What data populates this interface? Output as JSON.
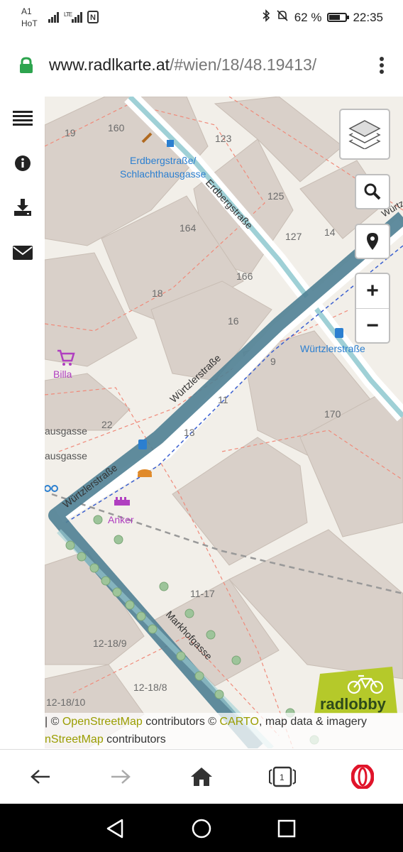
{
  "status": {
    "carrier_line1": "A1",
    "carrier_line2": "HoT",
    "network": "LTE",
    "battery": "62 %",
    "battery_level": 0.62,
    "time": "22:35"
  },
  "browser": {
    "url_host": "www.radlkarte.at",
    "url_path": "/#wien/18/48.19413/",
    "menu_icon": "kebab-menu-icon"
  },
  "sidebar": {
    "items": [
      {
        "icon": "menu-list-icon"
      },
      {
        "icon": "info-icon"
      },
      {
        "icon": "download-icon"
      },
      {
        "icon": "mail-icon"
      }
    ]
  },
  "map": {
    "controls": {
      "layers_icon": "layers-icon",
      "search_icon": "search-icon",
      "locate_icon": "location-pin-icon",
      "zoom_in": "+",
      "zoom_out": "−"
    },
    "labels": {
      "stop_1": "Erdbergstraße/",
      "stop_2": "Schlachthausgasse",
      "street_erdberg": "Erdbergstraße",
      "street_wuertzler": "Würtzlerstraße",
      "street_wuertzler_stop": "Würtzlerstraße",
      "street_wuertzler_2": "Würtzlerstraße",
      "street_markhof": "Markhofgasse",
      "street_wuertz_edge": "Würtz",
      "shop_billa": "Billa",
      "shop_anker": "Anker",
      "partial_gasse_1": "ausgasse",
      "partial_gasse_2": "ausgasse"
    },
    "house_numbers": {
      "n19": "19",
      "n160": "160",
      "n123": "123",
      "n125": "125",
      "n127": "127",
      "n14": "14",
      "n164": "164",
      "n166": "166",
      "n18": "18",
      "n16": "16",
      "n9": "9",
      "n11": "11",
      "n170": "170",
      "n22": "22",
      "n13": "13",
      "n11_17": "11-17",
      "n12_18_9": "12-18/9",
      "n12_18_8": "12-18/8",
      "n12_18_10": "12-18/10"
    },
    "attribution": {
      "prefix": "| © ",
      "osm": "OpenStreetMap",
      "contrib": " contributors © ",
      "carto": "CARTO",
      "rest": ", map data & imagery",
      "line2_link": "nStreetMap",
      "line2_rest": " contributors"
    },
    "logo_text": "radlobby",
    "colors": {
      "route": "#4f7f94",
      "road_light": "#9fd0d6",
      "building": "#d9d0c9",
      "background": "#f2efe9",
      "logo_green": "#b5c92a"
    }
  },
  "navbar": {
    "back_icon": "back-arrow-icon",
    "forward_icon": "forward-arrow-icon",
    "home_icon": "home-icon",
    "tabs_count": "1",
    "opera_icon": "opera-icon"
  },
  "system": {
    "back": "triangle-back-icon",
    "home": "circle-home-icon",
    "recent": "square-recent-icon"
  }
}
